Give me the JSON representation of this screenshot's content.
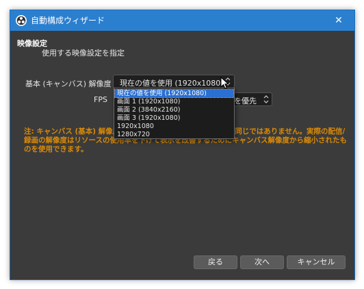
{
  "window": {
    "title": "自動構成ウィザード",
    "app_icon": "obs-logo-icon",
    "close_glyph": "✕"
  },
  "section": {
    "title": "映像設定",
    "subtitle": "使用する映像設定を指定"
  },
  "form": {
    "resolution_label": "基本 (キャンバス) 解像度",
    "resolution_value": "現在の値を使用 (1920x1080)",
    "fps_label": "FPS",
    "fps_value": "を優先"
  },
  "dropdown": {
    "options": [
      "現在の値を使用 (1920x1080)",
      "画面 1 (1920x1080)",
      "画面 2 (3840x2160)",
      "画面 3 (1920x1080)",
      "1920x1080",
      "1280x720"
    ],
    "selected_index": 0
  },
  "note": "注: キャンバス (基本) 解像度は必ずしも配信や録画する解像度と同じではありません。実際の配信/録画の解像度はリソースの使用率を下げて表示を改善するためにキャンバス解像度から縮小されたものを使用できます。",
  "buttons": {
    "back": "戻る",
    "next": "次へ",
    "cancel": "キャンセル"
  },
  "colors": {
    "titlebar": "#2b7fcf",
    "window_bg": "#3b3b3b",
    "note_text": "#d98a08",
    "selection": "#2a6fd1"
  }
}
